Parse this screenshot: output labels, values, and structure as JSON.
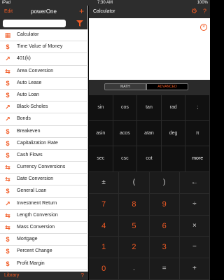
{
  "status_bar": {
    "carrier": "iPad",
    "time": "7:30 AM",
    "battery": "100%"
  },
  "left": {
    "edit": "Edit",
    "title": "powerOne",
    "add": "+",
    "search_placeholder": "",
    "footer_library": "Library",
    "footer_help": "?"
  },
  "templates": [
    {
      "label": "Calculator",
      "icon": "calculator-icon",
      "glyph": "▦"
    },
    {
      "label": "Time Value of Money",
      "icon": "dollar-icon",
      "glyph": "$"
    },
    {
      "label": "401(k)",
      "icon": "trend-chart-icon",
      "glyph": "↗"
    },
    {
      "label": "Area Conversion",
      "icon": "arrows-swap-icon",
      "glyph": "⇆"
    },
    {
      "label": "Auto Lease",
      "icon": "dollar-icon",
      "glyph": "$"
    },
    {
      "label": "Auto Loan",
      "icon": "dollar-icon",
      "glyph": "$"
    },
    {
      "label": "Black-Scholes",
      "icon": "trend-chart-icon",
      "glyph": "↗"
    },
    {
      "label": "Bonds",
      "icon": "trend-chart-icon",
      "glyph": "↗"
    },
    {
      "label": "Breakeven",
      "icon": "dollar-icon",
      "glyph": "$"
    },
    {
      "label": "Capitalization Rate",
      "icon": "dollar-icon",
      "glyph": "$"
    },
    {
      "label": "Cash Flows",
      "icon": "dollar-icon",
      "glyph": "$"
    },
    {
      "label": "Currency Conversions",
      "icon": "arrows-swap-icon",
      "glyph": "⇆"
    },
    {
      "label": "Date Conversion",
      "icon": "arrows-swap-icon",
      "glyph": "⇆"
    },
    {
      "label": "General Loan",
      "icon": "dollar-icon",
      "glyph": "$"
    },
    {
      "label": "Investment Return",
      "icon": "trend-chart-icon",
      "glyph": "↗"
    },
    {
      "label": "Length Conversion",
      "icon": "arrows-swap-icon",
      "glyph": "⇆"
    },
    {
      "label": "Mass Conversion",
      "icon": "arrows-swap-icon",
      "glyph": "⇆"
    },
    {
      "label": "Mortgage",
      "icon": "dollar-icon",
      "glyph": "$"
    },
    {
      "label": "Percent Change",
      "icon": "dollar-icon",
      "glyph": "$"
    },
    {
      "label": "Profit Margin",
      "icon": "dollar-icon",
      "glyph": "$"
    }
  ],
  "right": {
    "title": "Calculator",
    "settings_icon": "gear-icon",
    "help": "?",
    "clear": "×",
    "modes": {
      "math": "MATH",
      "advanced": "ADVANCED",
      "selected": "ADVANCED"
    }
  },
  "sci_keys": [
    [
      "sin",
      "cos",
      "tan",
      "rad",
      ";"
    ],
    [
      "asin",
      "acos",
      "atan",
      "deg",
      "π"
    ],
    [
      "sec",
      "csc",
      "cot",
      "",
      "more"
    ]
  ],
  "num_keys": [
    [
      "±",
      "(",
      ")",
      "←"
    ],
    [
      "7",
      "8",
      "9",
      "÷"
    ],
    [
      "4",
      "5",
      "6",
      "×"
    ],
    [
      "1",
      "2",
      "3",
      "−"
    ],
    [
      "0",
      ".",
      "=",
      "+"
    ]
  ],
  "colors": {
    "accent": "#f15a24",
    "dark_bar": "#2d2d2d",
    "keypad": "#1b1b1b"
  }
}
